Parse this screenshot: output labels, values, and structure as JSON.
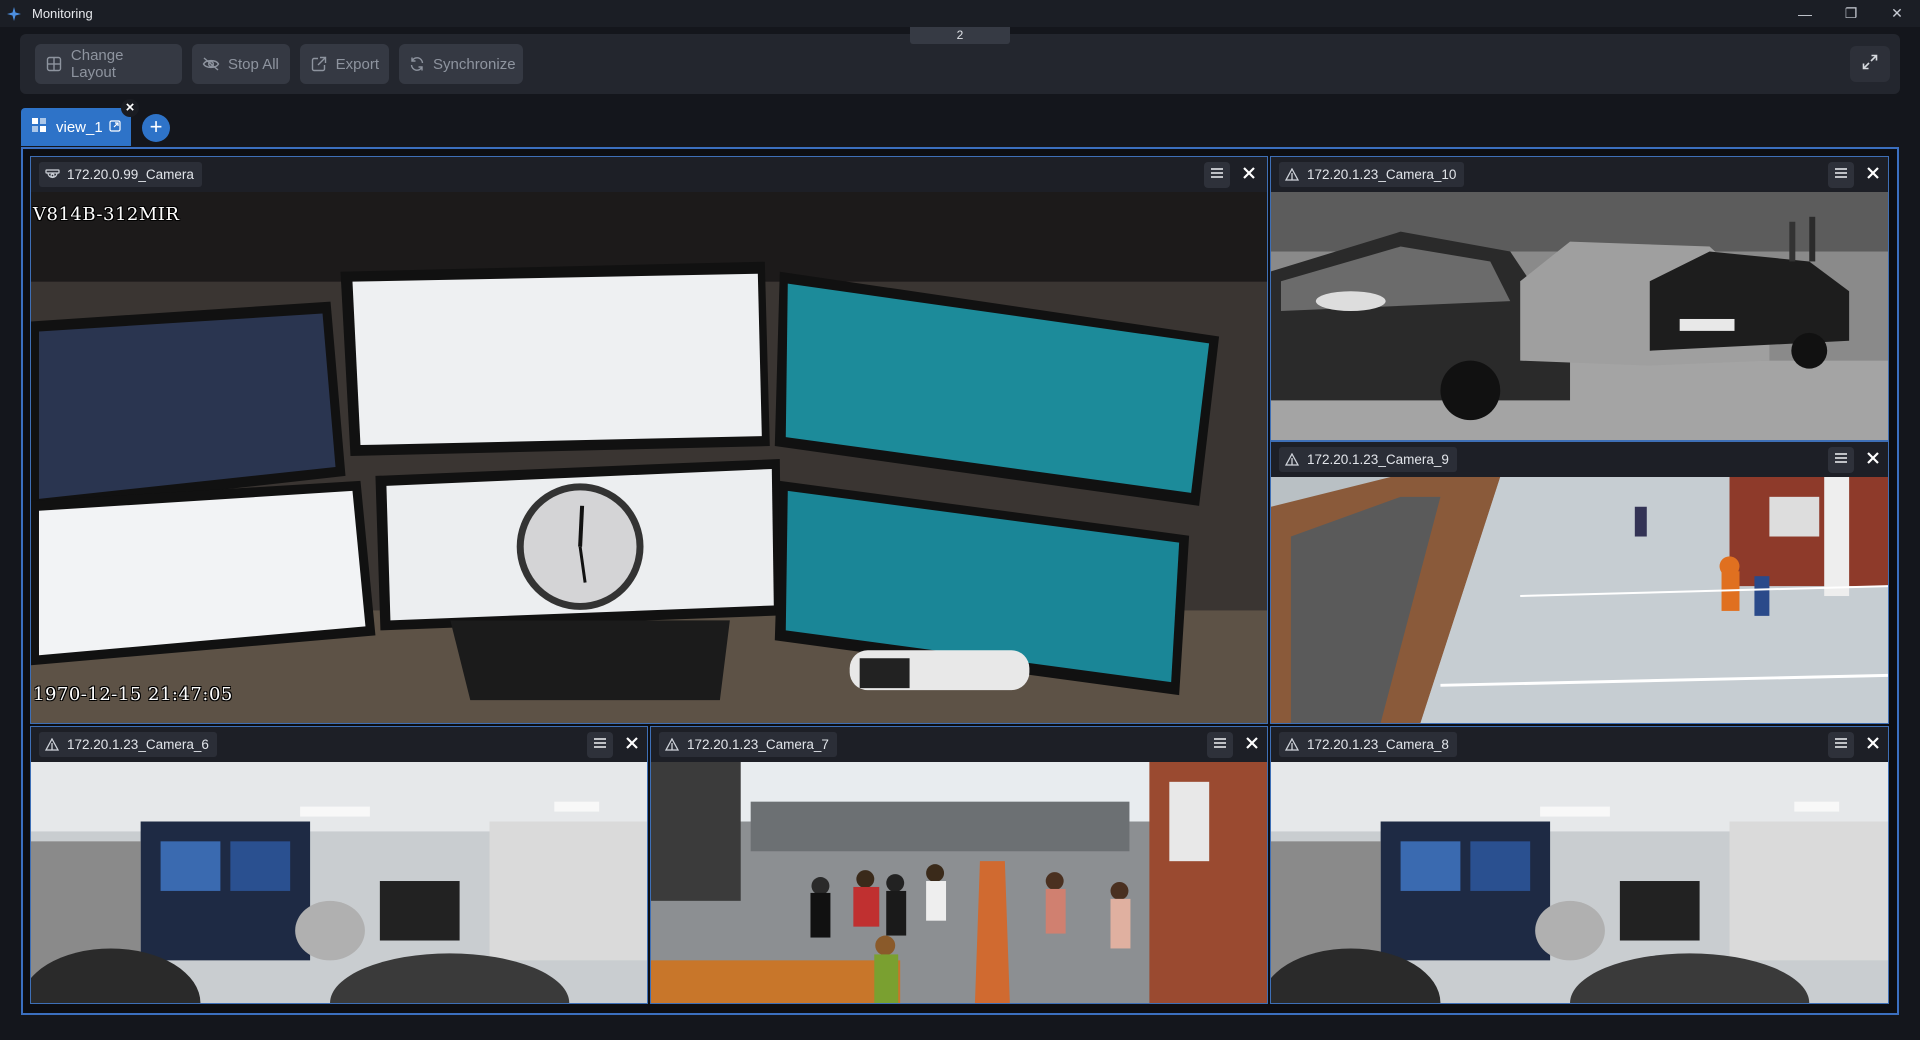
{
  "window": {
    "title": "Monitoring",
    "minimize_glyph": "—",
    "maximize_glyph": "❐",
    "close_glyph": "✕"
  },
  "toolbar": {
    "page_indicator": "2",
    "change_layout": "Change Layout",
    "stop_all": "Stop All",
    "export": "Export",
    "synchronize": "Synchronize"
  },
  "tabs": {
    "items": [
      {
        "label": "view_1"
      }
    ],
    "close_glyph": "×",
    "add_glyph": "+"
  },
  "cameras": [
    {
      "name": "172.20.0.99_Camera",
      "icon": "dome-camera-icon",
      "osd_model": "V814B-312MIR",
      "osd_timestamp": "1970-12-15 21:47:05"
    },
    {
      "name": "172.20.1.23_Camera_10",
      "icon": "ptz-camera-icon"
    },
    {
      "name": "172.20.1.23_Camera_9",
      "icon": "ptz-camera-icon"
    },
    {
      "name": "172.20.1.23_Camera_6",
      "icon": "ptz-camera-icon"
    },
    {
      "name": "172.20.1.23_Camera_7",
      "icon": "ptz-camera-icon"
    },
    {
      "name": "172.20.1.23_Camera_8",
      "icon": "ptz-camera-icon"
    }
  ],
  "colors": {
    "accent": "#2e73c8",
    "frame_border": "#3b6fbf",
    "background": "#14161c",
    "toolbar_bg": "#23262e"
  }
}
